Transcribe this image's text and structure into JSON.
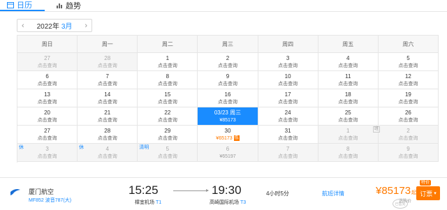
{
  "tabs": {
    "calendar_label": "日历",
    "trend_label": "趋势"
  },
  "month_selector": {
    "prev_icon": "‹",
    "next_icon": "›",
    "year": "2022年",
    "month": "3月"
  },
  "weekdays": [
    "周日",
    "周一",
    "周二",
    "周三",
    "周四",
    "周五",
    "周六"
  ],
  "query_label": "点击查询",
  "calendar": {
    "row1": [
      {
        "day": "27",
        "sub": "点击查询"
      },
      {
        "day": "28",
        "sub": "点击查询"
      },
      {
        "day": "1",
        "sub": "点击查询"
      },
      {
        "day": "2",
        "sub": "点击查询"
      },
      {
        "day": "3",
        "sub": "点击查询"
      },
      {
        "day": "4",
        "sub": "点击查询"
      },
      {
        "day": "5",
        "sub": "点击查询"
      }
    ],
    "row2": [
      {
        "day": "6",
        "sub": "点击查询"
      },
      {
        "day": "7",
        "sub": "点击查询"
      },
      {
        "day": "8",
        "sub": "点击查询"
      },
      {
        "day": "9",
        "sub": "点击查询"
      },
      {
        "day": "10",
        "sub": "点击查询"
      },
      {
        "day": "11",
        "sub": "点击查询"
      },
      {
        "day": "12",
        "sub": "点击查询"
      }
    ],
    "row3": [
      {
        "day": "13",
        "sub": "点击查询"
      },
      {
        "day": "14",
        "sub": "点击查询"
      },
      {
        "day": "15",
        "sub": "点击查询"
      },
      {
        "day": "16",
        "sub": "点击查询"
      },
      {
        "day": "17",
        "sub": "点击查询"
      },
      {
        "day": "18",
        "sub": "点击查询"
      },
      {
        "day": "19",
        "sub": "点击查询"
      }
    ],
    "row4": [
      {
        "day": "20",
        "sub": "点击查询"
      },
      {
        "day": "21",
        "sub": "点击查询"
      },
      {
        "day": "22",
        "sub": "点击查询"
      },
      {
        "day": "03/23 周三",
        "sub": "¥85173"
      },
      {
        "day": "24",
        "sub": "点击查询"
      },
      {
        "day": "25",
        "sub": "点击查询"
      },
      {
        "day": "26",
        "sub": "点击查询"
      }
    ],
    "row5": [
      {
        "day": "27",
        "sub": "点击查询"
      },
      {
        "day": "28",
        "sub": "点击查询"
      },
      {
        "day": "29",
        "sub": "点击查询"
      },
      {
        "day": "30",
        "sub": "¥65173"
      },
      {
        "day": "31",
        "sub": "点击查询"
      },
      {
        "day": "1",
        "sub": "点击查询"
      },
      {
        "day": "2",
        "sub": "点击查询"
      }
    ],
    "row6": [
      {
        "day": "3",
        "sub": "点击查询"
      },
      {
        "day": "4",
        "sub": "点击查询"
      },
      {
        "day": "5",
        "sub": "点击查询"
      },
      {
        "day": "6",
        "sub": "¥65197"
      },
      {
        "day": "7",
        "sub": "点击查询"
      },
      {
        "day": "8",
        "sub": "点击查询"
      },
      {
        "day": "9",
        "sub": "点击查询"
      }
    ]
  },
  "tags": {
    "low_tag": "低",
    "holiday": "休",
    "qingming": "清明",
    "side_tag": "班"
  },
  "flight": {
    "airline": "厦门航空",
    "flight_no": "MF852 波音787(大)",
    "dep_time": "15:25",
    "dep_airport": "樟宜机场",
    "dep_terminal": "T1",
    "arr_time": "19:30",
    "arr_airport": "高崎国际机场",
    "arr_terminal": "T3",
    "duration": "4小时5分",
    "detail_label": "航班详情",
    "price": "¥85173",
    "price_suffix": "起",
    "price_note": "选购价",
    "book_label": "订票",
    "book_badge": "特价",
    "stamp": "已售完"
  },
  "colors": {
    "accent": "#1a8cff",
    "price": "#ff7a00"
  }
}
